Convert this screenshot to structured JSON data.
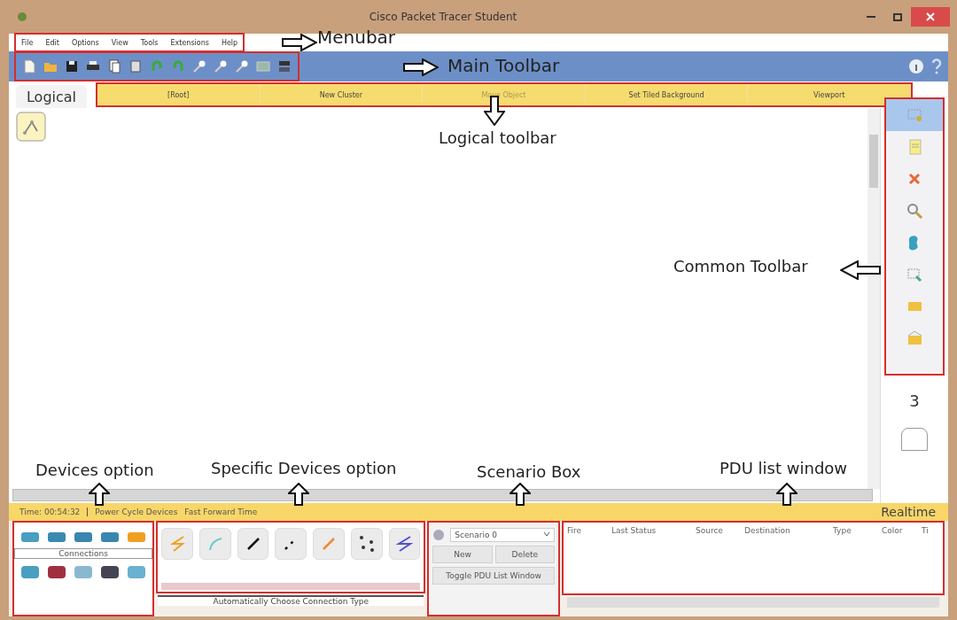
{
  "window": {
    "title": "Cisco Packet Tracer Student"
  },
  "menubar": [
    "File",
    "Edit",
    "Options",
    "View",
    "Tools",
    "Extensions",
    "Help"
  ],
  "workspace_tab": "Logical",
  "logical_toolbar": [
    {
      "label": "[Root]",
      "disabled": false
    },
    {
      "label": "New Cluster",
      "disabled": false
    },
    {
      "label": "Move Object",
      "disabled": true
    },
    {
      "label": "Set Tiled Background",
      "disabled": false
    },
    {
      "label": "Viewport",
      "disabled": false
    }
  ],
  "common_toolbar": [
    {
      "selected": true
    },
    {
      "selected": false
    },
    {
      "selected": false
    },
    {
      "selected": false
    },
    {
      "selected": false
    },
    {
      "selected": false
    },
    {
      "selected": false
    },
    {
      "selected": false
    }
  ],
  "page_number": "3",
  "status_bar": {
    "time": "Time: 00:54:32",
    "actions": [
      "Power Cycle Devices",
      "Fast Forward Time"
    ],
    "mode": "Realtime"
  },
  "devices": {
    "category_label": "Connections"
  },
  "connection_hint": "Automatically Choose Connection Type",
  "scenario": {
    "name": "Scenario 0",
    "buttons": [
      "New",
      "Delete"
    ],
    "toggle": "Toggle PDU List Window"
  },
  "pdu_list": {
    "columns": [
      "Fire",
      "Last Status",
      "Source",
      "Destination",
      "Type",
      "Color",
      "Ti"
    ]
  },
  "annotations": [
    {
      "label": "Menubar"
    },
    {
      "label": "Main Toolbar"
    },
    {
      "label": "Logical toolbar"
    },
    {
      "label": "Common Toolbar"
    },
    {
      "label": "Devices option"
    },
    {
      "label": "Specific Devices option"
    },
    {
      "label": "Scenario Box"
    },
    {
      "label": "PDU list window"
    }
  ]
}
